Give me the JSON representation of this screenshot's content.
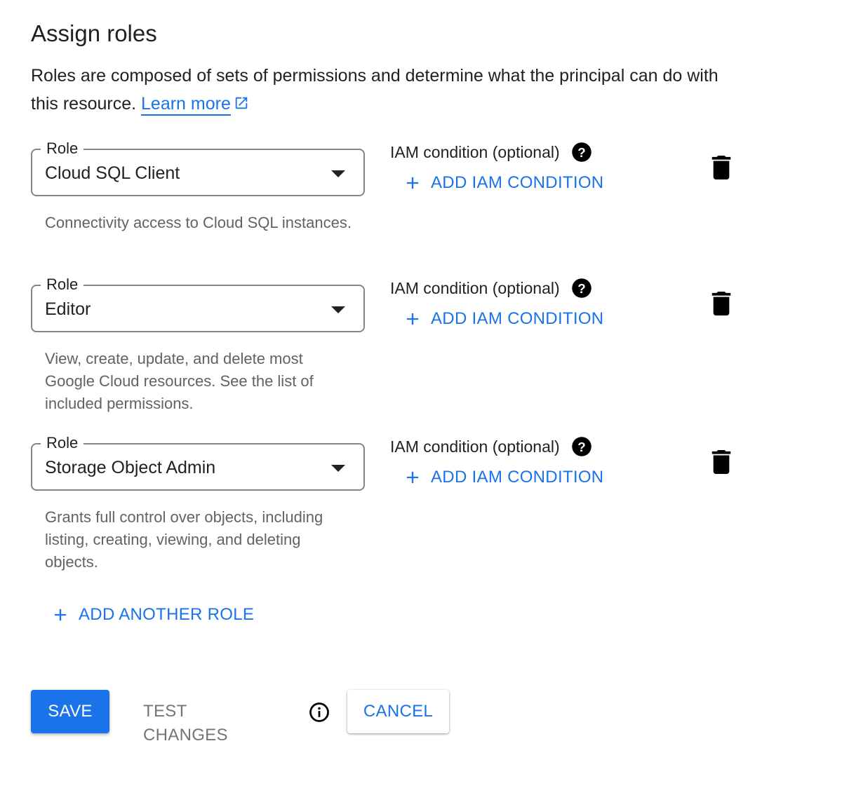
{
  "header": {
    "title": "Assign roles",
    "description": "Roles are composed of sets of permissions and determine what the principal can do with this resource.",
    "learn_more": "Learn more"
  },
  "roles": [
    {
      "legend": "Role",
      "value": "Cloud SQL Client",
      "description": "Connectivity access to Cloud SQL instances.",
      "condition_label": "IAM condition (optional)",
      "add_condition": "ADD IAM CONDITION"
    },
    {
      "legend": "Role",
      "value": "Editor",
      "description": "View, create, update, and delete most Google Cloud resources. See the list of included permissions.",
      "condition_label": "IAM condition (optional)",
      "add_condition": "ADD IAM CONDITION"
    },
    {
      "legend": "Role",
      "value": "Storage Object Admin",
      "description": "Grants full control over objects, including listing, creating, viewing, and deleting objects.",
      "condition_label": "IAM condition (optional)",
      "add_condition": "ADD IAM CONDITION"
    }
  ],
  "add_role": "ADD ANOTHER ROLE",
  "actions": {
    "save": "SAVE",
    "test_changes": "TEST CHANGES",
    "cancel": "CANCEL"
  },
  "colors": {
    "accent": "#1a73e8",
    "text": "#202124",
    "muted": "#5f6368"
  },
  "icons": {
    "external_link": "external-link-icon",
    "help": "help-circle-icon",
    "plus": "plus-icon",
    "trash": "trash-icon",
    "caret": "caret-down-icon",
    "info": "info-icon"
  }
}
